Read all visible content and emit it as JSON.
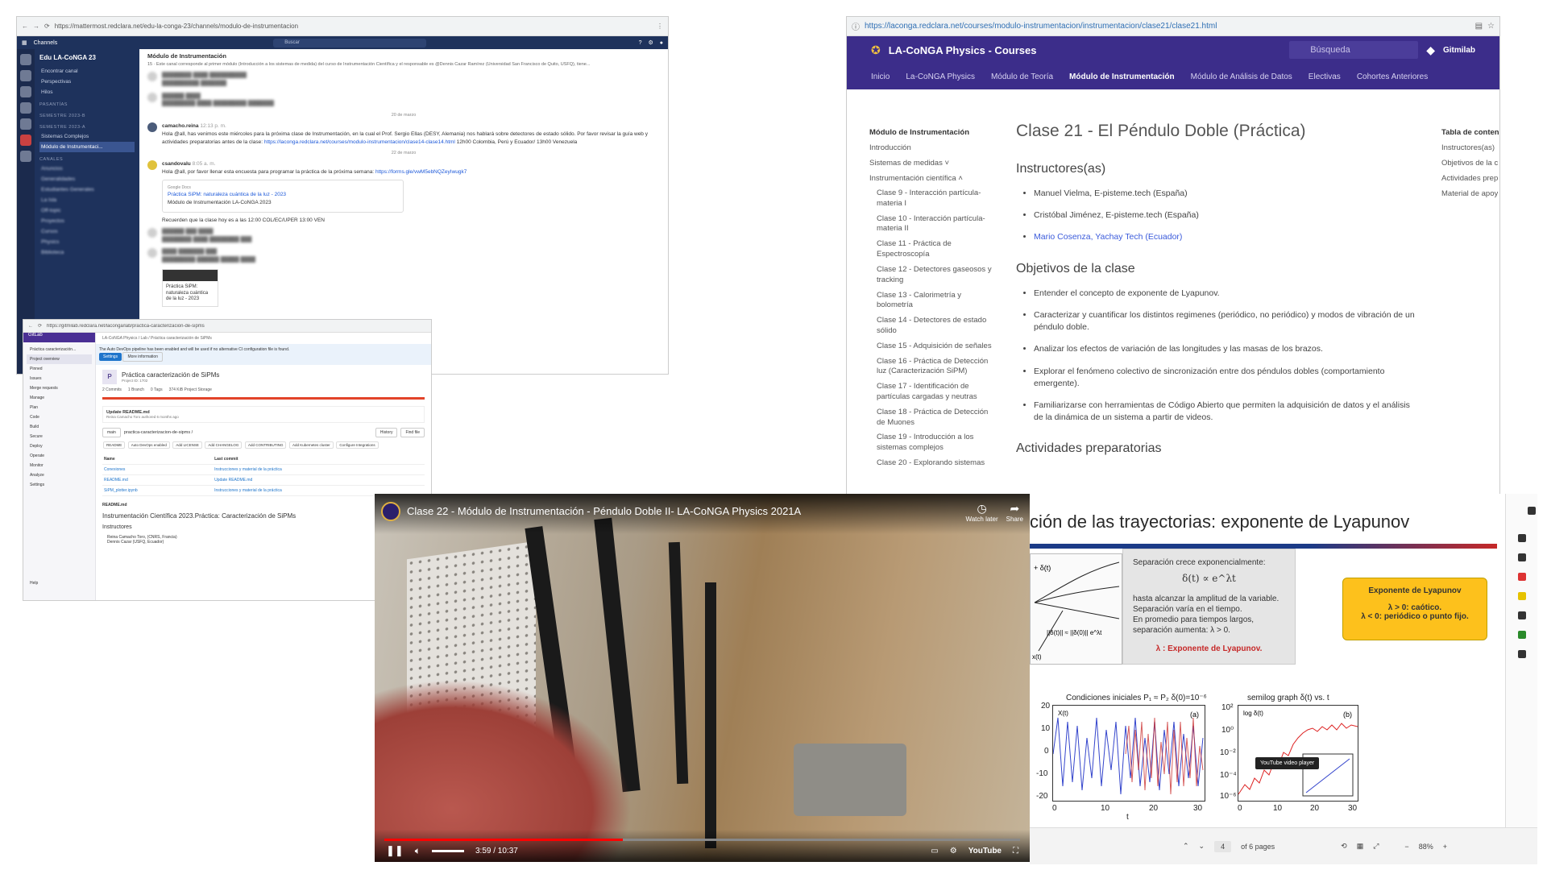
{
  "mattermost": {
    "url": "https://mattermost.redclara.net/edu-la-conga-23/channels/modulo-de-instrumentacion",
    "channels_btn": "Channels",
    "search_placeholder": "Buscar",
    "workspace": "Edu LA-CoNGA 23",
    "find_channel": "Encontrar canal",
    "perspectives": "Perspectivas",
    "threads": "Hilos",
    "sec_pasantias": "PASANTÍAS",
    "sec_sem2023b": "SEMESTRE 2023-B",
    "sec_sem2023a": "SEMESTRE 2023-A",
    "ch_sistemas": "Sistemas Complejos",
    "ch_modulo": "Módulo de Instrumentaci...",
    "sec_canales": "CANALES",
    "blurred_items": [
      "Anuncios",
      "Generalidades",
      "Estudiantes Generales",
      "La Isla",
      "Off-topic",
      "Proyectos",
      "Cursos",
      "Physics",
      "Biblioteca"
    ],
    "channel_title": "Módulo de Instrumentación",
    "channel_meta": "15",
    "channel_desc": "Este canal corresponde al primer módulo (Introducción a los sistemas de medida) del curso de Instrumentación Científica y el responsable es @Dennis Cazar Ramírez (Universidad San Francisco de Quito, USFQ), tiene...",
    "date1": "20 de marzo",
    "post1_user": "camacho.reina",
    "post1_time": "12:13 p. m.",
    "post1_text": "Hola @all, has venimos este miércoles para la próxima clase de Instrumentación, en la cual el Prof. Sergio Ellas (DESY, Alemania) nos hablará sobre detectores de estado sólido. Por favor revisar la guía web y actividades preparatorias antes de la clase:",
    "post1_link": "https://laconga.redclara.net/courses/modulo-instrumentacion/clase14-clase14.html",
    "post1_tail": "12h00 Colombia, Perú y Ecuador/ 13h00 Venezuela",
    "date2": "22 de marzo",
    "post2_user": "csandovalu",
    "post2_time": "8:05 a. m.",
    "post2_text": "Hola @all, por favor llenar esta encuesta para programar la práctica de la próxima semana:",
    "post2_link": "https://forms.gle/vwM5ebNQZeyIwugk7",
    "card_src": "Google Docs",
    "card_title": "Práctica SiPM: naturaleza cuántica de la luz - 2023",
    "card_sub": "Módulo de Instrumentación LA-CoNGA 2023",
    "reminder": "Recuerden que la clase hoy es a las 12:00 COL/EC/UPER 13:00 VEN",
    "thumb_text": "Práctica SiPM: naturaleza cuántica de la luz - 2023"
  },
  "gitlab": {
    "url": "https://gitmilab.redclara.net/laconga/lab/practica-caracterizacion-de-sipms",
    "brand": "GitLab",
    "crumb": "LA-CoNGA Physics  /  Lab  /  Práctica caracterización de SiPMs",
    "project_short": "Práctica caracterización...",
    "nav": [
      "Project overview",
      "Pinned",
      "Issues",
      "Merge requests",
      "Manage",
      "Plan",
      "Code",
      "Build",
      "Secure",
      "Deploy",
      "Operate",
      "Monitor",
      "Analyze",
      "Settings"
    ],
    "help": "Help",
    "banner": "The Auto DevOps pipeline has been enabled and will be used if no alternative CI configuration file is found.",
    "btn_settings": "Settings",
    "btn_more": "More information",
    "avatar_letter": "P",
    "project_name": "Práctica caracterización de SiPMs",
    "project_id": "Project ID: 1702",
    "stats": [
      "2 Commits",
      "1 Branch",
      "0 Tags",
      "374 KiB Project Storage"
    ],
    "commit_title": "Update README.md",
    "commit_by": "Reina Camacho Toro authored 6 months ago",
    "branch": "main",
    "path": "practica-caracterizacion-de-sipms /",
    "btn_history": "History",
    "btn_find": "Find file",
    "pills": [
      "README",
      "Auto DevOps enabled",
      "Add LICENSE",
      "Add CHANGELOG",
      "Add CONTRIBUTING",
      "Add Kubernetes cluster",
      "Configure Integrations"
    ],
    "col_name": "Name",
    "col_commit": "Last commit",
    "rows": [
      {
        "name": "Conexiones",
        "commit": "Instrucciones y material de la práctica"
      },
      {
        "name": "README.md",
        "commit": "Update README.md"
      },
      {
        "name": "SiPM_plotter.ipynb",
        "commit": "Instrucciones y material de la práctica"
      }
    ],
    "readme_label": "README.md",
    "readme_title": "Instrumentación Científica 2023.Práctica: Caracterización de SiPMs",
    "instructors_h": "Instructores",
    "instructors": [
      "Reina Camacho Toro, (CNRS, Francia)",
      "Dennis Cazar (USFQ, Ecuador)"
    ]
  },
  "laconga": {
    "url": "https://laconga.redclara.net/courses/modulo-instrumentacion/instrumentacion/clase21/clase21.html",
    "brand": "LA-CoNGA Physics - Courses",
    "search": "Búsqueda",
    "gitlab": "Gitmilab",
    "nav": [
      "Inicio",
      "La-CoNGA Physics",
      "Módulo de Teoría",
      "Módulo de Instrumentación",
      "Módulo de Análisis de Datos",
      "Electivas",
      "Cohortes Anteriores"
    ],
    "side_title": "Módulo de Instrumentación",
    "side_items": [
      "Introducción",
      "Sistemas de medidas ˅",
      "Instrumentación científica ˄"
    ],
    "side_sub": [
      "Clase 9 - Interacción partícula-materia I",
      "Clase 10 - Interacción partícula-materia II",
      "Clase 11 - Práctica de Espectroscopía",
      "Clase 12 - Detectores gaseosos y tracking",
      "Clase 13 - Calorimetría y bolometría",
      "Clase 14 - Detectores de estado sólido",
      "Clase 15 - Adquisición de señales",
      "Clase 16 - Práctica de Detección luz (Caracterización SiPM)",
      "Clase 17 - Identificación de partículas cargadas y neutras",
      "Clase 18 - Práctica de Detección de Muones",
      "Clase 19 - Introducción a los sistemas complejos",
      "Clase 20 - Explorando sistemas"
    ],
    "title": "Clase 21 - El Péndulo Doble (Práctica)",
    "h_instr": "Instructores(as)",
    "instructors": [
      "Manuel Vielma, E-pisteme.tech (España)",
      "Cristóbal Jiménez, E-pisteme.tech (España)"
    ],
    "instructor_link": "Mario Cosenza, Yachay Tech (Ecuador)",
    "h_obj": "Objetivos de la clase",
    "objectives": [
      "Entender el concepto de exponente de Lyapunov.",
      "Caracterizar y cuantificar los distintos regimenes (periódico, no periódico) y modos de vibración de un péndulo doble.",
      "Analizar los efectos de variación de las longitudes y las masas de los brazos.",
      "Explorar el fenómeno colectivo de sincronización entre dos péndulos dobles (comportamiento emergente).",
      "Familiarizarse con herramientas de Código Abierto que permiten la adquisición de datos y el análisis de la dinámica de un sistema a partir de videos."
    ],
    "h_act": "Actividades preparatorias",
    "toc_title": "Tabla de conten",
    "toc": [
      "Instructores(as)",
      "Objetivos de la c",
      "Actividades prep",
      "Material de apoy"
    ]
  },
  "youtube": {
    "title": "Clase 22 - Módulo de Instrumentación - Péndulo Doble II- LA-CoNGA Physics 2021A",
    "watch_later": "Watch later",
    "share": "Share",
    "time": "3:59 / 10:37",
    "progress": 0.375,
    "brand": "YouTube"
  },
  "slide": {
    "title": "ción de las trayectorias: exponente de Lyapunov",
    "sep_line1": "Separación crece exponencialmente:",
    "formula": "δ(t) ∝ e^λt",
    "sep_line2": "hasta alcanzar la amplitud de la variable.",
    "sep_line3": "Separación varía en el tiempo.",
    "sep_line4": "En promedio para tiempos largos,",
    "sep_line5": "separación aumenta:  λ > 0.",
    "lambda_note": "λ :  Exponente de Lyapunov.",
    "box_title": "Exponente de Lyapunov",
    "box_line1": "λ > 0:    caótico.",
    "box_line2": "λ < 0: periódico o punto fijo.",
    "plot_a_title": "Condiciones iniciales P₁ ≈ P₂  δ(0)=10⁻⁶",
    "plot_a_label": "(a)",
    "plot_a_ylabel": "X(t)",
    "plot_b_title": "semilog graph δ(t) vs. t",
    "plot_b_label": "(b)",
    "plot_b_ylabel": "log δ(t)",
    "ticks_a_y": [
      "20",
      "10",
      "0",
      "-10",
      "-20"
    ],
    "ticks_a_x": [
      "0",
      "10",
      "20",
      "30"
    ],
    "ticks_b_y": [
      "10²",
      "10⁰",
      "10⁻²",
      "10⁻⁴",
      "10⁻⁶"
    ],
    "ticks_b_x": [
      "0",
      "10",
      "20",
      "30"
    ],
    "xlabel": "t",
    "tooltip": "YouTube video player",
    "page": "4",
    "of_pages": "of 6 pages",
    "zoom": "88%"
  }
}
